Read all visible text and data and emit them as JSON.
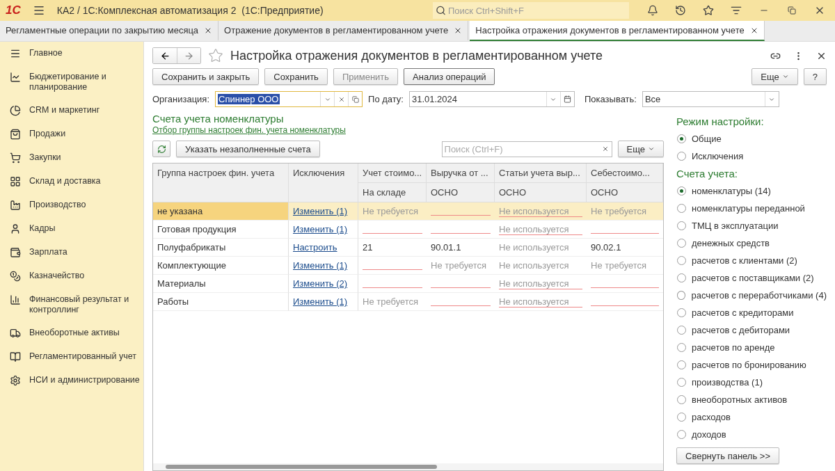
{
  "app_bar": {
    "logo": "1С",
    "title": "КА2 / 1С:Комплексная автоматизация 2  (1С:Предприятие)",
    "search": {
      "placeholder": "Поиск Ctrl+Shift+F"
    }
  },
  "tabs": [
    {
      "label": "Регламентные операции по закрытию месяца",
      "selected": false
    },
    {
      "label": "Отражение документов в регламентированном учете",
      "selected": false
    },
    {
      "label": "Настройка отражения документов в регламентированном учете",
      "selected": true
    }
  ],
  "sidebar": {
    "items": [
      {
        "label": "Главное"
      },
      {
        "label": "Бюджетирование и планирование"
      },
      {
        "label": "CRM и маркетинг"
      },
      {
        "label": "Продажи"
      },
      {
        "label": "Закупки"
      },
      {
        "label": "Склад и доставка"
      },
      {
        "label": "Производство"
      },
      {
        "label": "Кадры"
      },
      {
        "label": "Зарплата"
      },
      {
        "label": "Казначейство"
      },
      {
        "label": "Финансовый результат и контроллинг"
      },
      {
        "label": "Внеоборотные активы"
      },
      {
        "label": "Регламентированный учет"
      },
      {
        "label": "НСИ и администрирование"
      }
    ]
  },
  "form": {
    "title": "Настройка отражения документов в регламентированном учете",
    "buttons": [
      {
        "label": "Сохранить и закрыть",
        "disabled": false
      },
      {
        "label": "Сохранить",
        "disabled": false
      },
      {
        "label": "Применить",
        "disabled": true
      },
      {
        "label": "Анализ операций",
        "disabled": false
      }
    ],
    "more_button": "Еще",
    "help_button": "?",
    "organization": {
      "label": "Организация:",
      "value": "Спиннер ООО"
    },
    "date": {
      "label": "По дату:",
      "value": "31.01.2024"
    },
    "show": {
      "label": "Показывать:",
      "value": "Все"
    },
    "section_title": "Счета учета номенклатуры",
    "filter_link": "Отбор группы настроек фин. учета номенклатуры",
    "fill_button": "Указать незаполненные счета",
    "table_search": {
      "placeholder": "Поиск (Ctrl+F)"
    },
    "table_more": "Еще",
    "table": {
      "columns": [
        {
          "title": "Группа настроек фин. учета"
        },
        {
          "title": "Исключения"
        },
        {
          "title": "Учет стоимо...",
          "subtitle": "На складе"
        },
        {
          "title": "Выручка от ...",
          "subtitle": "ОСНО"
        },
        {
          "title": "Статьи учета выр...",
          "subtitle": "ОСНО"
        },
        {
          "title": "Себестоимо...",
          "subtitle": "ОСНО"
        }
      ],
      "rows": [
        {
          "selected": true,
          "cells": [
            {
              "kind": "text",
              "text": "не указана"
            },
            {
              "kind": "link",
              "text": "Изменить (1)"
            },
            {
              "kind": "hint",
              "text": "Не требуется"
            },
            {
              "kind": "empty"
            },
            {
              "kind": "hint-underlined",
              "text": "Не используется"
            },
            {
              "kind": "hint",
              "text": "Не требуется"
            }
          ]
        },
        {
          "selected": false,
          "cells": [
            {
              "kind": "text",
              "text": "Готовая продукция"
            },
            {
              "kind": "link",
              "text": "Изменить (1)"
            },
            {
              "kind": "empty"
            },
            {
              "kind": "empty"
            },
            {
              "kind": "hint-underlined",
              "text": "Не используется"
            },
            {
              "kind": "empty"
            }
          ]
        },
        {
          "selected": false,
          "cells": [
            {
              "kind": "text",
              "text": "Полуфабрикаты"
            },
            {
              "kind": "link",
              "text": "Настроить"
            },
            {
              "kind": "text",
              "text": "21"
            },
            {
              "kind": "text",
              "text": "90.01.1"
            },
            {
              "kind": "hint",
              "text": "Не используется"
            },
            {
              "kind": "text",
              "text": "90.02.1"
            }
          ]
        },
        {
          "selected": false,
          "cells": [
            {
              "kind": "text",
              "text": "Комплектующие"
            },
            {
              "kind": "link",
              "text": "Изменить (1)"
            },
            {
              "kind": "empty"
            },
            {
              "kind": "hint",
              "text": "Не требуется"
            },
            {
              "kind": "hint",
              "text": "Не используется"
            },
            {
              "kind": "hint",
              "text": "Не требуется"
            }
          ]
        },
        {
          "selected": false,
          "cells": [
            {
              "kind": "text",
              "text": "Материалы"
            },
            {
              "kind": "link",
              "text": "Изменить (2)"
            },
            {
              "kind": "empty"
            },
            {
              "kind": "empty"
            },
            {
              "kind": "hint-underlined",
              "text": "Не используется"
            },
            {
              "kind": "empty"
            }
          ]
        },
        {
          "selected": false,
          "cells": [
            {
              "kind": "text",
              "text": "Работы"
            },
            {
              "kind": "link",
              "text": "Изменить (1)"
            },
            {
              "kind": "hint",
              "text": "Не требуется"
            },
            {
              "kind": "empty"
            },
            {
              "kind": "hint-underlined",
              "text": "Не используется"
            },
            {
              "kind": "empty"
            }
          ]
        }
      ]
    }
  },
  "panel": {
    "mode_title": "Режим настройки:",
    "modes": [
      {
        "label": "Общие",
        "selected": true
      },
      {
        "label": "Исключения",
        "selected": false
      }
    ],
    "accounts_title": "Счета учета:",
    "accounts": [
      {
        "label": "номенклатуры (14)",
        "selected": true
      },
      {
        "label": "номенклатуры переданной",
        "selected": false
      },
      {
        "label": "ТМЦ в эксплуатации",
        "selected": false
      },
      {
        "label": "денежных средств",
        "selected": false
      },
      {
        "label": "расчетов с клиентами (2)",
        "selected": false
      },
      {
        "label": "расчетов с поставщиками (2)",
        "selected": false
      },
      {
        "label": "расчетов с переработчиками (4)",
        "selected": false
      },
      {
        "label": "расчетов с кредиторами",
        "selected": false
      },
      {
        "label": "расчетов с дебиторами",
        "selected": false
      },
      {
        "label": "расчетов по аренде",
        "selected": false
      },
      {
        "label": "расчетов по бронированию",
        "selected": false
      },
      {
        "label": "производства (1)",
        "selected": false
      },
      {
        "label": "внеоборотных активов",
        "selected": false
      },
      {
        "label": "расходов",
        "selected": false
      },
      {
        "label": "доходов",
        "selected": false
      }
    ],
    "collapse_button": "Свернуть панель >>"
  }
}
